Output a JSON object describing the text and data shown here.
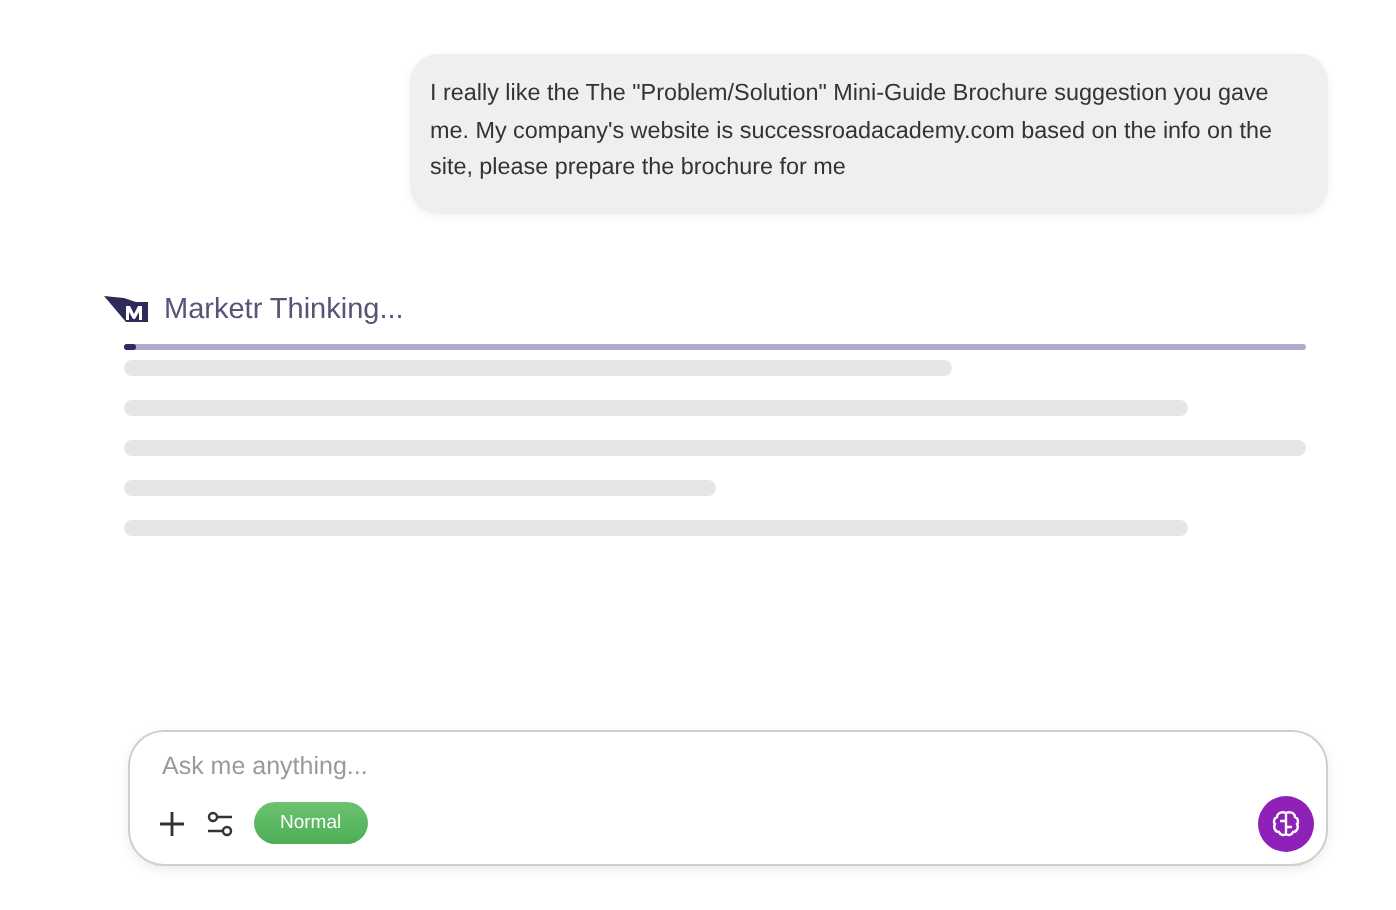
{
  "user_message": {
    "text": "I really like the The \"Problem/Solution\" Mini-Guide Brochure suggestion you gave me. My company's website is successroadacademy.com based on the info on the site, please prepare the brochure for me"
  },
  "assistant": {
    "status": "Marketr Thinking...",
    "progress": {
      "level": 0.01
    }
  },
  "composer": {
    "placeholder": "Ask me anything...",
    "mode": "Normal"
  }
}
